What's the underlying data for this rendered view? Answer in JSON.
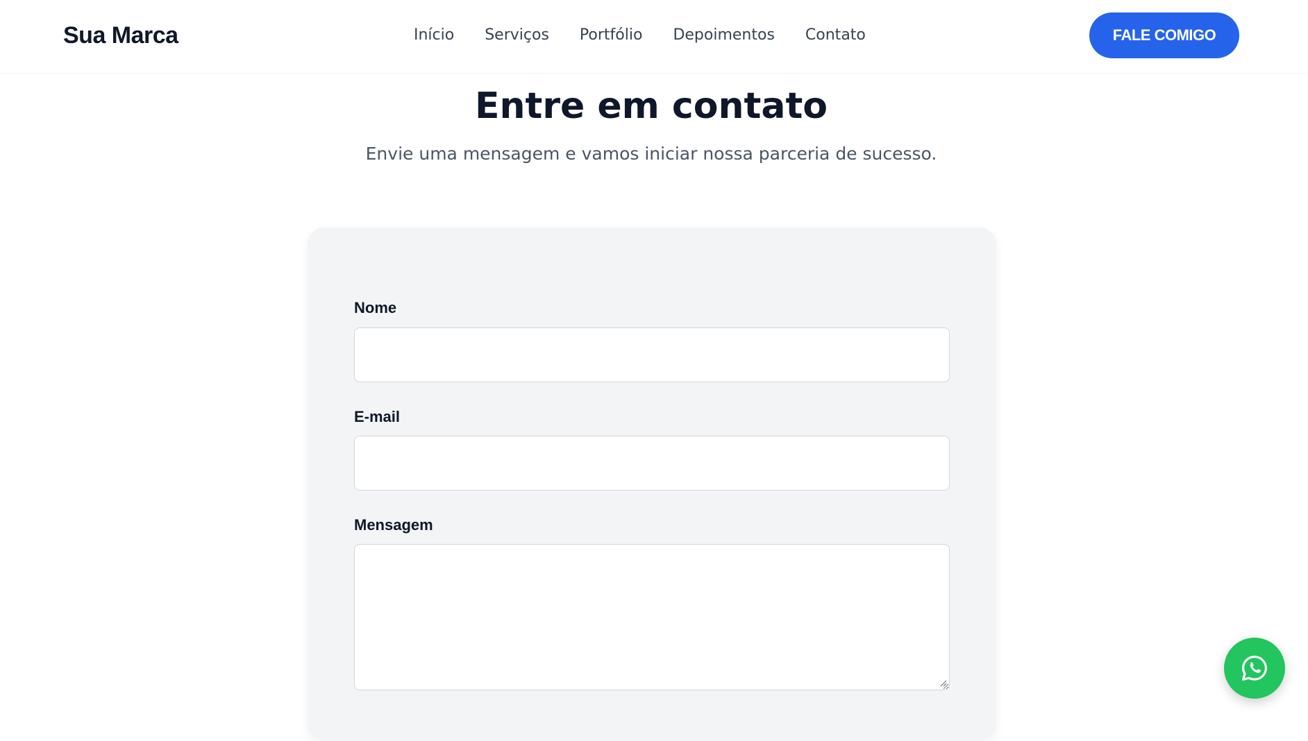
{
  "header": {
    "brand": "Sua Marca",
    "nav": [
      {
        "label": "Início"
      },
      {
        "label": "Serviços"
      },
      {
        "label": "Portfólio"
      },
      {
        "label": "Depoimentos"
      },
      {
        "label": "Contato"
      }
    ],
    "cta_label": "FALE COMIGO"
  },
  "contact": {
    "title": "Entre em contato",
    "subtitle": "Envie uma mensagem e vamos iniciar nossa parceria de sucesso.",
    "form": {
      "name_label": "Nome",
      "name_value": "",
      "email_label": "E-mail",
      "email_value": "",
      "message_label": "Mensagem",
      "message_value": ""
    }
  },
  "floating": {
    "icon": "whatsapp-icon"
  },
  "colors": {
    "accent": "#2563eb",
    "whatsapp": "#22c55e",
    "card_bg": "#f3f4f6",
    "text_dark": "#0f172a",
    "text_muted": "#4b5563"
  }
}
